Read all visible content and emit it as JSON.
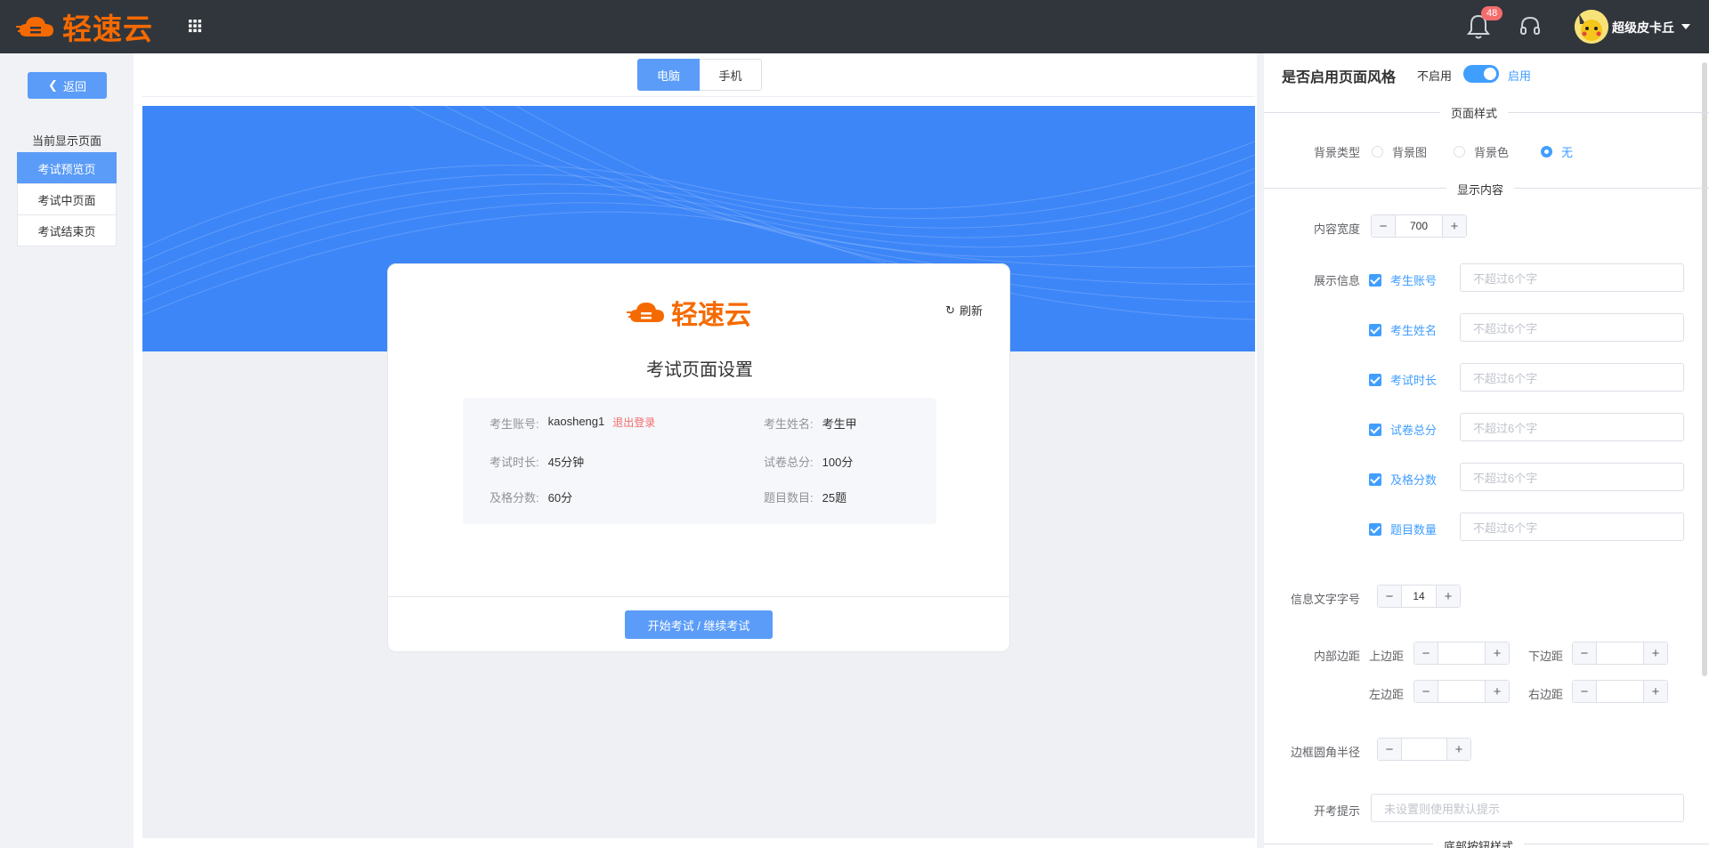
{
  "header": {
    "brand": "轻速云",
    "notifications_count": "48",
    "username": "超级皮卡丘",
    "colors": {
      "bar": "#31363d",
      "brand": "#f56a00",
      "badge": "#f56c6c"
    }
  },
  "sidebar": {
    "back_label": "返回",
    "section_title": "当前显示页面",
    "items": [
      {
        "label": "考试预览页",
        "active": true
      },
      {
        "label": "考试中页面",
        "active": false
      },
      {
        "label": "考试结束页",
        "active": false
      }
    ]
  },
  "device_tabs": [
    {
      "label": "电脑",
      "active": true
    },
    {
      "label": "手机",
      "active": false
    }
  ],
  "preview": {
    "brand": "轻速云",
    "refresh_label": "刷新",
    "title": "考试页面设置",
    "info": {
      "account_label": "考生账号:",
      "account_value": "kaosheng1",
      "logout_label": "退出登录",
      "name_label": "考生姓名:",
      "name_value": "考生甲",
      "duration_label": "考试时长:",
      "duration_value": "45分钟",
      "total_label": "试卷总分:",
      "total_value": "100分",
      "pass_label": "及格分数:",
      "pass_value": "60分",
      "count_label": "题目数目:",
      "count_value": "25题"
    },
    "start_button": "开始考试 / 继续考试",
    "banner_color": "#3d86f8"
  },
  "settings": {
    "title": "是否启用页面风格",
    "switch_off_label": "不启用",
    "switch_on_label": "启用",
    "switch_on": true,
    "page_style_section": "页面样式",
    "bg_type_label": "背景类型",
    "bg_options": [
      {
        "label": "背景图",
        "selected": false
      },
      {
        "label": "背景色",
        "selected": false
      },
      {
        "label": "无",
        "selected": true
      }
    ],
    "content_section": "显示内容",
    "content_width_label": "内容宽度",
    "content_width_value": "700",
    "show_info_label": "展示信息",
    "show_info_items": [
      {
        "label": "考生账号",
        "placeholder": "不超过6个字"
      },
      {
        "label": "考生姓名",
        "placeholder": "不超过6个字"
      },
      {
        "label": "考试时长",
        "placeholder": "不超过6个字"
      },
      {
        "label": "试卷总分",
        "placeholder": "不超过6个字"
      },
      {
        "label": "及格分数",
        "placeholder": "不超过6个字"
      },
      {
        "label": "题目数量",
        "placeholder": "不超过6个字"
      }
    ],
    "font_size_label": "信息文字字号",
    "font_size_value": "14",
    "padding_label": "内部边距",
    "padding_top_label": "上边距",
    "padding_bottom_label": "下边距",
    "padding_left_label": "左边距",
    "padding_right_label": "右边距",
    "radius_label": "边框圆角半径",
    "tip_label": "开考提示",
    "tip_placeholder": "未设置则使用默认提示",
    "bottom_section": "底部按钮样式",
    "accent": "#409eff"
  }
}
